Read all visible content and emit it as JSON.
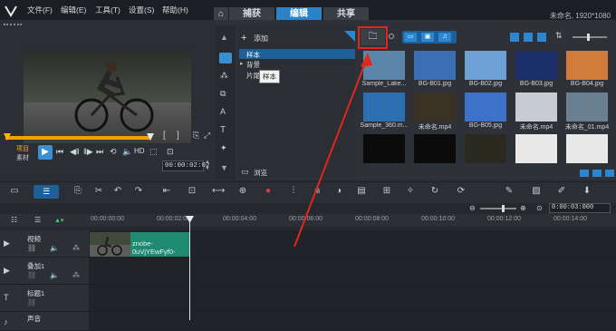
{
  "menu": [
    "文件(F)",
    "编辑(E)",
    "工具(T)",
    "设置(S)",
    "帮助(H)"
  ],
  "tabs": [
    {
      "label": "捕获",
      "active": false
    },
    {
      "label": "编辑",
      "active": true
    },
    {
      "label": "共享",
      "active": false
    }
  ],
  "project_info": "未命名, 1920*1080",
  "player": {
    "mode_project": "项目",
    "mode_clip": "素材",
    "hd_label": "HD",
    "timecode": "00:00:02:02",
    "bracket_in": "[",
    "bracket_out": "]"
  },
  "library": {
    "add_label": "添加",
    "tree": [
      {
        "label": "样本",
        "selected": true
      },
      {
        "label": "背景",
        "selected": false
      },
      {
        "label": "片尾",
        "selected": false
      }
    ],
    "tooltip": "样本",
    "browse_label": "浏览",
    "thumbnails": [
      {
        "label": "Sample_Lake...",
        "color": "#5b86a9"
      },
      {
        "label": "BG-B01.jpg",
        "color": "#3b6fb5"
      },
      {
        "label": "BG-B02.jpg",
        "color": "#6fa0d6"
      },
      {
        "label": "BG-B03.jpg",
        "color": "#1b2f6a"
      },
      {
        "label": "BG-B04.jpg",
        "color": "#d27c3c"
      },
      {
        "label": "Sample_360.m...",
        "color": "#2b6fb0"
      },
      {
        "label": "未命名.mp4",
        "color": "#3b3226"
      },
      {
        "label": "BG-B05.jpg",
        "color": "#3c72c8"
      },
      {
        "label": "未命名.mp4",
        "color": "#c6ccd2"
      },
      {
        "label": "未命名_01.mp4",
        "color": "#6b7f92"
      },
      {
        "label": "",
        "color": "#0b0b0b"
      },
      {
        "label": "",
        "color": "#0b0b0b"
      },
      {
        "label": "",
        "color": "#2a2a20"
      },
      {
        "label": "",
        "color": "#e8e8e8"
      },
      {
        "label": "",
        "color": "#e8e8e8"
      }
    ]
  },
  "timeline": {
    "ruler": [
      "00:00:00:00",
      "00:00:02:00",
      "00:00:04:00",
      "00:00:06:00",
      "00:00:08:00",
      "00:00:10:00",
      "00:00:12:00",
      "00:00:14:00"
    ],
    "zoom_time": "0:00:03:000",
    "tracks": [
      {
        "name": "视频"
      },
      {
        "name": "叠加1"
      },
      {
        "name": "标题1"
      },
      {
        "name": "声音"
      }
    ],
    "clip_label": "znobe-0uVjYEwFyf0-"
  }
}
